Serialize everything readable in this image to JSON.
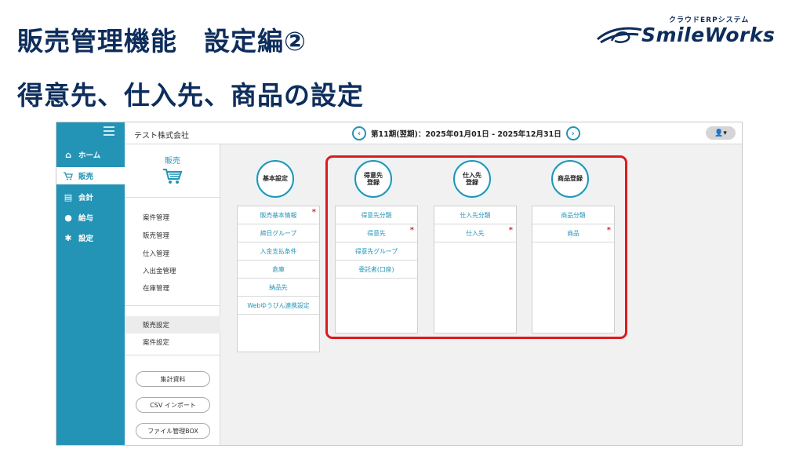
{
  "slide": {
    "title_line1": "販売管理機能　設定編②",
    "title_line2": "得意先、仕入先、商品の設定"
  },
  "logo": {
    "tagline": "クラウドERPシステム",
    "name": "SmileWorks",
    "color": "#0d2d5c"
  },
  "app": {
    "company": "テスト株式会社",
    "period": "第11期(翌期)：2025年01月01日 - 2025年12月31日",
    "prev_icon": "chevron-left-icon",
    "next_icon": "chevron-right-icon",
    "user_icon": "user-icon",
    "user_symbol": "👤▾",
    "accent": "#2394b5"
  },
  "sidebar": {
    "items": [
      {
        "label": "ホーム",
        "icon": "home-icon",
        "symbol": "⌂"
      },
      {
        "label": "販売",
        "icon": "cart-icon",
        "symbol": "🛒"
      },
      {
        "label": "会計",
        "icon": "calculator-icon",
        "symbol": "▤"
      },
      {
        "label": "給与",
        "icon": "money-bag-icon",
        "symbol": "●"
      },
      {
        "label": "設定",
        "icon": "gear-icon",
        "symbol": "✱"
      }
    ]
  },
  "subnav": {
    "title": "販売",
    "links": [
      "案件管理",
      "販売管理",
      "仕入管理",
      "入出金管理",
      "在庫管理"
    ],
    "settings": [
      "販売設定",
      "案件設定"
    ],
    "buttons": [
      "集計資料",
      "CSV インポート",
      "ファイル管理BOX"
    ]
  },
  "columns": [
    {
      "title": "基本設定",
      "rows": [
        {
          "label": "販売基本情報",
          "required": true
        },
        {
          "label": "締日グループ",
          "required": false
        },
        {
          "label": "入金支払条件",
          "required": false
        },
        {
          "label": "倉庫",
          "required": false
        },
        {
          "label": "納品先",
          "required": false
        },
        {
          "label": "Webゆうびん連携設定",
          "required": false
        }
      ]
    },
    {
      "title": "得意先\n登録",
      "rows": [
        {
          "label": "得意先分類",
          "required": false
        },
        {
          "label": "得意先",
          "required": true
        },
        {
          "label": "得意先グループ",
          "required": false
        },
        {
          "label": "委託者(口座)",
          "required": false
        }
      ]
    },
    {
      "title": "仕入先\n登録",
      "rows": [
        {
          "label": "仕入先分類",
          "required": false
        },
        {
          "label": "仕入先",
          "required": true
        }
      ]
    },
    {
      "title": "商品登録",
      "rows": [
        {
          "label": "商品分類",
          "required": false
        },
        {
          "label": "商品",
          "required": true
        }
      ]
    }
  ],
  "required_mark": "*",
  "highlight_color": "#e0191f"
}
